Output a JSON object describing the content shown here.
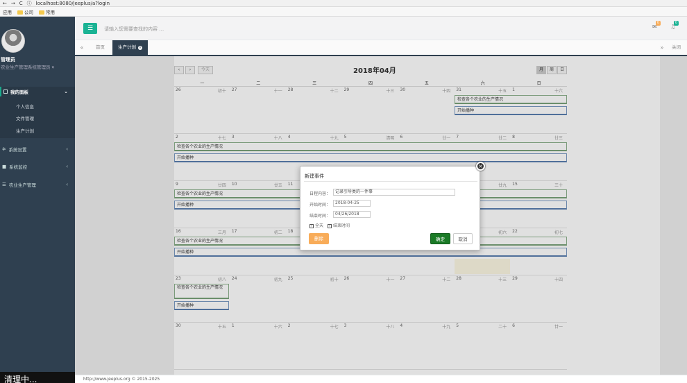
{
  "browser": {
    "url": "localhost:8080/jeeplus/a?login"
  },
  "bookmarks": [
    "应用",
    "公司",
    "常用"
  ],
  "user": {
    "name": "管理员",
    "role": "农业生产管理系统管理员"
  },
  "sidebar": {
    "sections": [
      {
        "label": "我的面板"
      },
      {
        "label": "系统设置"
      },
      {
        "label": "系统监控"
      },
      {
        "label": "农业生产管理"
      }
    ],
    "sub_items": [
      "个人信息",
      "文件管理",
      "生产计划"
    ],
    "toast": "清理中..."
  },
  "topbar": {
    "search_placeholder": "请输入您需要查找的内容 …",
    "mail_count": "0",
    "bell_count": "0"
  },
  "tabs": {
    "items": [
      "首页",
      "生产计划"
    ],
    "close_label": "关闭操作"
  },
  "calendar": {
    "title": "2018年04月",
    "today_label": "今天",
    "view_month": "月",
    "view_week": "周",
    "view_day": "日",
    "weekdays": [
      "一",
      "二",
      "三",
      "四",
      "五",
      "六",
      "日"
    ],
    "weeks": [
      {
        "days": [
          [
            "26",
            "初十"
          ],
          [
            "27",
            "十一"
          ],
          [
            "28",
            "十二"
          ],
          [
            "29",
            "十三"
          ],
          [
            "30",
            "十四"
          ],
          [
            "31",
            "十五"
          ],
          [
            "1",
            "十六"
          ]
        ]
      },
      {
        "days": [
          [
            "2",
            "十七"
          ],
          [
            "3",
            "十八"
          ],
          [
            "4",
            "十九"
          ],
          [
            "5",
            "清明"
          ],
          [
            "6",
            "廿一"
          ],
          [
            "7",
            "廿二"
          ],
          [
            "8",
            "廿三"
          ]
        ]
      },
      {
        "days": [
          [
            "9",
            "廿四"
          ],
          [
            "10",
            "廿五"
          ],
          [
            "11",
            "廿六"
          ],
          [
            "12",
            "廿七"
          ],
          [
            "13",
            "廿八"
          ],
          [
            "14",
            "廿九"
          ],
          [
            "15",
            "三十"
          ]
        ]
      },
      {
        "days": [
          [
            "16",
            "三月"
          ],
          [
            "17",
            "初二"
          ],
          [
            "18",
            "初三"
          ],
          [
            "19",
            "初四"
          ],
          [
            "20",
            "谷雨"
          ],
          [
            "21",
            "初六"
          ],
          [
            "22",
            "初七"
          ]
        ]
      },
      {
        "days": [
          [
            "23",
            "初八"
          ],
          [
            "24",
            "初九"
          ],
          [
            "25",
            "初十"
          ],
          [
            "26",
            "十一"
          ],
          [
            "27",
            "十二"
          ],
          [
            "28",
            "十三"
          ],
          [
            "29",
            "十四"
          ]
        ]
      },
      {
        "days": [
          [
            "30",
            "十五"
          ],
          [
            "1",
            "十六"
          ],
          [
            "2",
            "十七"
          ],
          [
            "3",
            "十八"
          ],
          [
            "4",
            "十九"
          ],
          [
            "5",
            "二十"
          ],
          [
            "6",
            "廿一"
          ]
        ]
      }
    ],
    "event_check": "检查各个农业的生产情况",
    "event_check_wrapped": "检查各个农业的生产情况",
    "event_start": "开始播种"
  },
  "modal": {
    "title": "新建事件",
    "content_label": "日程内容：",
    "content_value": "记录引导类的一件事",
    "start_label": "开始时间：",
    "start_value": "2018-04-25",
    "end_label": "结束时间：",
    "end_value": "04/26/2018",
    "allday_label": "全天",
    "endtime_label": "结束时间",
    "delete_label": "删除",
    "confirm_label": "确定",
    "cancel_label": "取消"
  },
  "footer": {
    "text": "http://www.jeeplus.org © 2015-2025"
  }
}
